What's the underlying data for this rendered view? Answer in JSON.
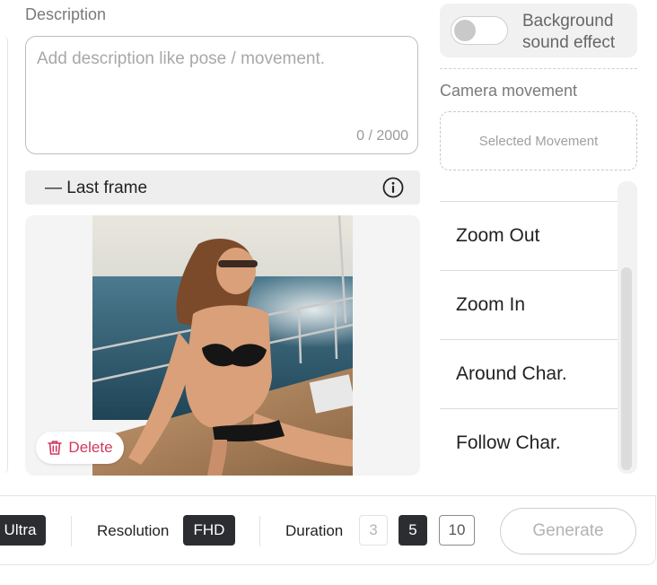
{
  "description": {
    "label": "Description",
    "placeholder": "Add description like pose / movement.",
    "counter": "0 / 2000"
  },
  "last_frame": {
    "label": "— Last frame",
    "info_icon": "info-icon",
    "delete_label": "Delete",
    "delete_icon": "trash-icon"
  },
  "background_sound": {
    "label": "Background sound effect",
    "enabled": false
  },
  "camera": {
    "label": "Camera movement",
    "selected_placeholder": "Selected Movement",
    "items": [
      "Zoom Out",
      "Zoom In",
      "Around Char.",
      "Follow Char."
    ]
  },
  "toolbar": {
    "quality_value": "Ultra",
    "resolution_label": "Resolution",
    "resolution_value": "FHD",
    "duration_label": "Duration",
    "durations": [
      "3",
      "5",
      "10"
    ],
    "duration_selected": "5",
    "generate_label": "Generate"
  },
  "colors": {
    "dark_chip": "#2b2d31",
    "delete_red": "#d03a5f"
  }
}
